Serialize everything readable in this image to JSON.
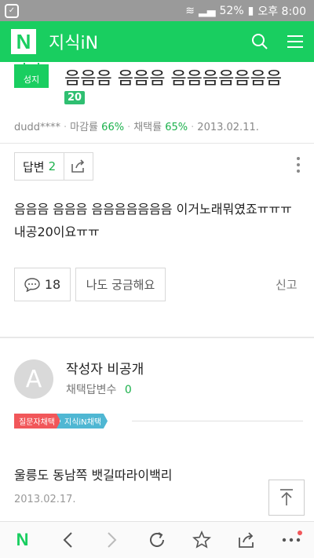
{
  "status": {
    "battery": "52%",
    "time": "오후 8:00"
  },
  "header": {
    "logo": "N",
    "title": "지식iN"
  },
  "question": {
    "badge": "성지",
    "title": "음음음 음음음 음음음음음음음",
    "points": "20",
    "author": "dudd****",
    "close_label": "마감률",
    "close_rate": "66%",
    "adopt_label": "채택률",
    "adopt_rate": "65%",
    "date": "2013.02.11.",
    "answer_label": "답변",
    "answer_count": "2",
    "body": "음음음 음음음 음음음음음음음 이거노래뭐였죠ㅠㅠㅠ내공20이요ㅠㅠ",
    "like_count": "18",
    "curious_label": "나도 궁금해요",
    "report_label": "신고"
  },
  "answer": {
    "avatar_letter": "A",
    "writer": "작성자 비공개",
    "adopt_label": "채택답변수",
    "adopt_count": "0",
    "tag_asker": "질문자채택",
    "tag_kin": "지식iN채택",
    "body": "울릉도 동남쪽 뱃길따라이백리",
    "date": "2013.02.17."
  },
  "bottom": {
    "logo": "N"
  },
  "colors": {
    "brand": "#19ce60",
    "accent_green": "#1cb14c",
    "tag_red": "#f1575a",
    "tag_blue": "#4fb7d3"
  }
}
